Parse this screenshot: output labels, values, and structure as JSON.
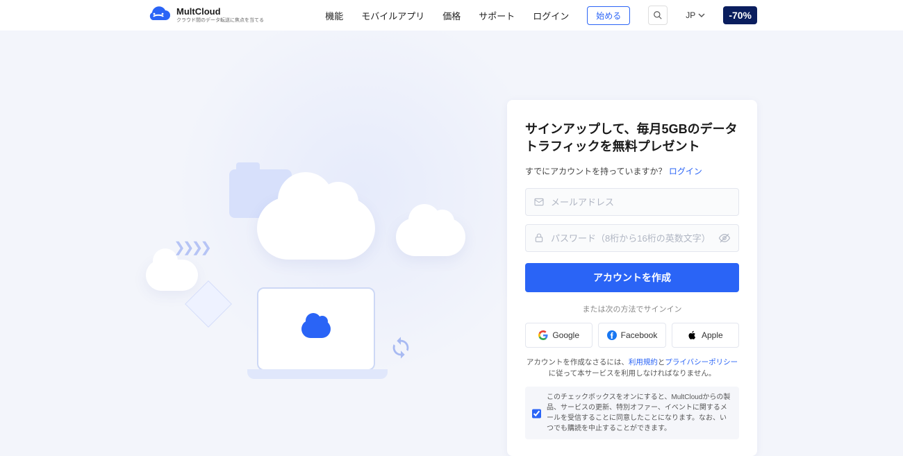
{
  "brand": {
    "name": "MultCloud",
    "tagline": "クラウド間のデータ転送に焦点を当てる"
  },
  "nav": {
    "features": "機能",
    "mobile": "モバイルアプリ",
    "pricing": "価格",
    "support": "サポート",
    "login": "ログイン",
    "start": "始める",
    "language": "JP"
  },
  "promo": {
    "label": "-70%"
  },
  "signup": {
    "title": "サインアップして、毎月5GBのデータトラフィックを無料プレゼント",
    "already_prompt": "すでにアカウントを持っていますか？",
    "login_link": "ログイン",
    "email_placeholder": "メールアドレス",
    "password_placeholder": "パスワード（8桁から16桁の英数文字）",
    "create_button": "アカウントを作成",
    "alt_signin": "または次の方法でサインイン",
    "social": {
      "google": "Google",
      "facebook": "Facebook",
      "apple": "Apple"
    },
    "terms_pre": "アカウントを作成なさるには、",
    "terms_link": "利用規約",
    "terms_mid": "と",
    "privacy_link": "プライバシーポリシー",
    "terms_post": "に従って本サービスを利用しなければなりません。",
    "consent_text": "このチェックボックスをオンにすると、MultCloudからの製品、サービスの更新、特別オファー、イベントに関するメールを受信することに同意したことになります。なお、いつでも購読を中止することができます。",
    "consent_checked": true
  }
}
